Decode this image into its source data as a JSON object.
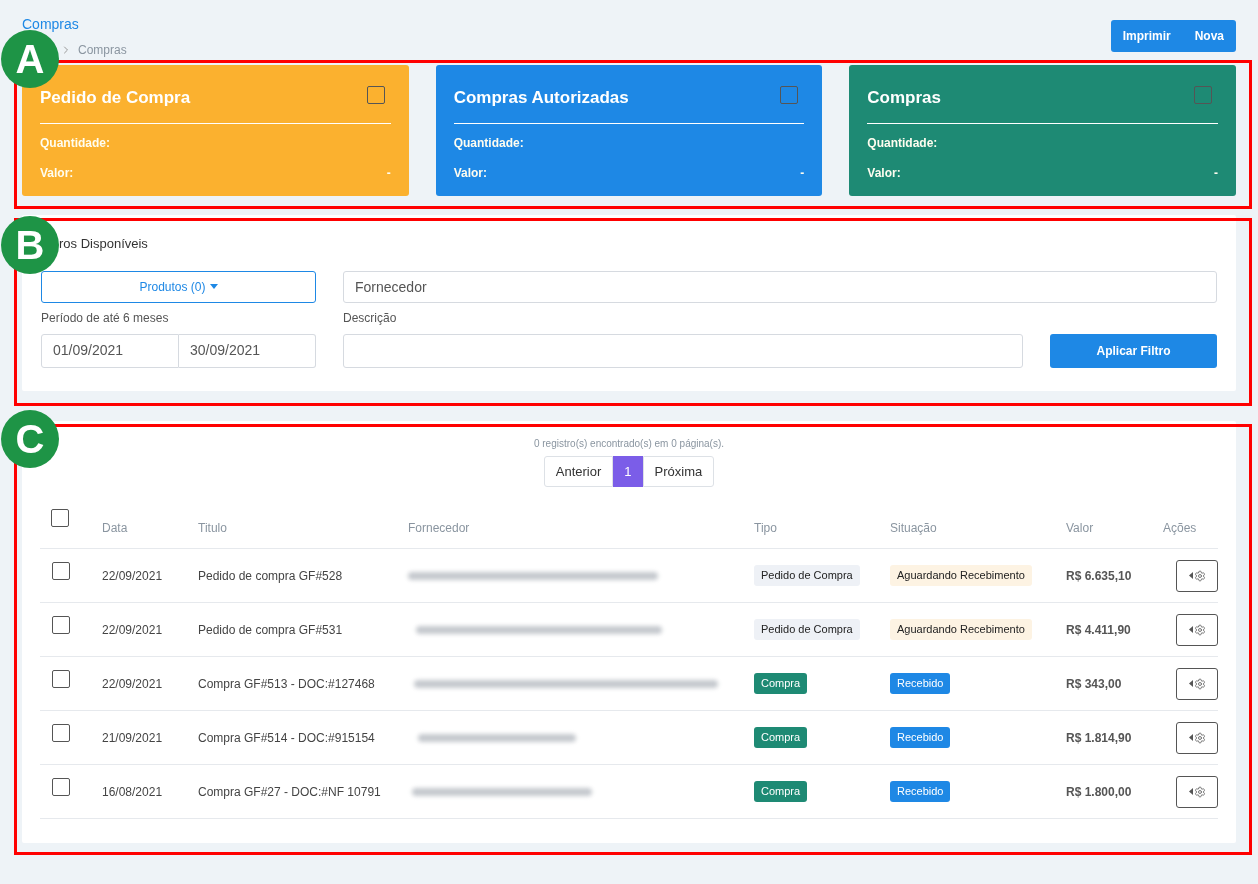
{
  "header": {
    "title": "Compras",
    "breadcrumb": "Compras",
    "buttons": [
      "Imprimir",
      "Nova"
    ]
  },
  "annotations": [
    {
      "letter": "A"
    },
    {
      "letter": "B"
    },
    {
      "letter": "C"
    }
  ],
  "cards": [
    {
      "title": "Pedido de Compra",
      "color": "#fbb12f",
      "checked": false,
      "quantity_label": "Quantidade:",
      "value_label": "Valor:",
      "value": "-"
    },
    {
      "title": "Compras Autorizadas",
      "color": "#1e88e5",
      "checked": false,
      "quantity_label": "Quantidade:",
      "value_label": "Valor:",
      "value": "-"
    },
    {
      "title": "Compras",
      "color": "#1e8a74",
      "checked": false,
      "quantity_label": "Quantidade:",
      "value_label": "Valor:",
      "value": "-"
    }
  ],
  "filters": {
    "title": "ros Disponíveis",
    "products_button": "Produtos (0)",
    "supplier": {
      "placeholder": "Fornecedor"
    },
    "period_label": "Período de até 6 meses",
    "date_from": "01/09/2021",
    "date_to": "30/09/2021",
    "description_label": "Descrição",
    "apply_button": "Aplicar Filtro"
  },
  "results": {
    "summary": "0 registro(s) encontrado(s) em 0 página(s).",
    "prev": "Anterior",
    "pages": [
      {
        "label": "1",
        "selected": true
      }
    ],
    "next": "Próxima"
  },
  "table": {
    "select_all_checked": false,
    "columns": [
      "Data",
      "Titulo",
      "Fornecedor",
      "Tipo",
      "Situação",
      "Valor",
      "Ações"
    ],
    "rows": [
      {
        "checked": false,
        "date": "22/09/2021",
        "title": "Pedido de compra GF#528",
        "type": {
          "label": "Pedido de Compra",
          "color": "#eef1f6"
        },
        "status": {
          "label": "Aguardando Recebimento",
          "color": "#fdf3e3"
        },
        "value": "R$ 6.635,10"
      },
      {
        "checked": false,
        "date": "22/09/2021",
        "title": "Pedido de compra GF#531",
        "type": {
          "label": "Pedido de Compra",
          "color": "#eef1f6"
        },
        "status": {
          "label": "Aguardando Recebimento",
          "color": "#fdf3e3"
        },
        "value": "R$ 4.411,90"
      },
      {
        "checked": false,
        "date": "22/09/2021",
        "title": "Compra GF#513 - DOC:#127468",
        "type": {
          "label": "Compra",
          "color": "#1e8a74"
        },
        "status": {
          "label": "Recebido",
          "color": "#1e88e5"
        },
        "value": "R$ 343,00"
      },
      {
        "checked": false,
        "date": "21/09/2021",
        "title": "Compra GF#514 - DOC:#915154",
        "type": {
          "label": "Compra",
          "color": "#1e8a74"
        },
        "status": {
          "label": "Recebido",
          "color": "#1e88e5"
        },
        "value": "R$ 1.814,90"
      },
      {
        "checked": false,
        "date": "16/08/2021",
        "title": "Compra GF#27 - DOC:#NF 10791",
        "type": {
          "label": "Compra",
          "color": "#1e8a74"
        },
        "status": {
          "label": "Recebido",
          "color": "#1e88e5"
        },
        "value": "R$ 1.800,00"
      }
    ]
  }
}
